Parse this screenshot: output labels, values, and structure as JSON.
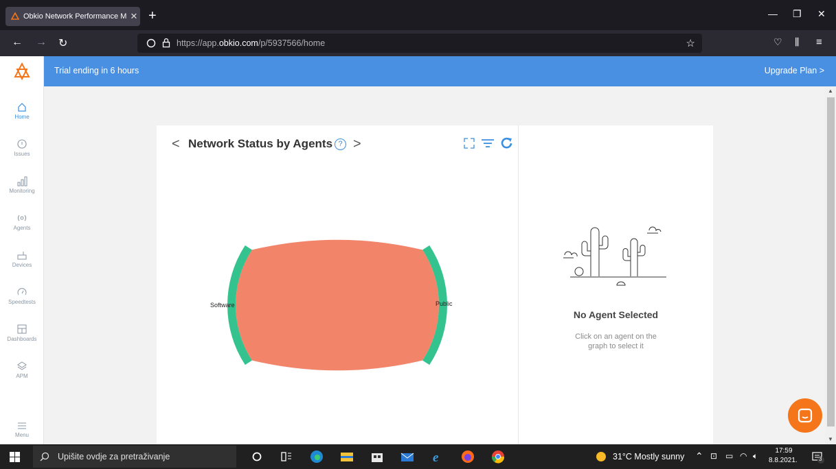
{
  "browser": {
    "tab_title": "Obkio Network Performance M",
    "tab_close": "✕",
    "new_tab": "+",
    "url_prefix": "https://app.",
    "url_domain": "obkio.com",
    "url_path": "/p/5937566/home"
  },
  "banner": {
    "message": "Trial ending in 6 hours",
    "upgrade_label": "Upgrade Plan >"
  },
  "sidebar": {
    "items": [
      {
        "label": "Home",
        "icon": "home-icon"
      },
      {
        "label": "Issues",
        "icon": "alert-circle-icon"
      },
      {
        "label": "Monitoring",
        "icon": "bar-chart-icon"
      },
      {
        "label": "Agents",
        "icon": "broadcast-icon"
      },
      {
        "label": "Devices",
        "icon": "router-icon"
      },
      {
        "label": "Speedtests",
        "icon": "gauge-icon"
      },
      {
        "label": "Dashboards",
        "icon": "dashboard-icon"
      },
      {
        "label": "APM",
        "icon": "layers-icon"
      }
    ],
    "menu_label": "Menu"
  },
  "widget": {
    "title": "Network Status by Agents",
    "help": "?",
    "prev": "<",
    "next": ">"
  },
  "chart_data": {
    "type": "chord",
    "nodes": [
      "Software",
      "Public"
    ],
    "colors": {
      "arc": "#34c38f",
      "ribbon": "#f2846a"
    }
  },
  "empty_state": {
    "title": "No Agent Selected",
    "line1": "Click on an agent on the",
    "line2": "graph to select it"
  },
  "taskbar": {
    "search_placeholder": "Upišite ovdje za pretraživanje",
    "weather": "31°C  Mostly sunny",
    "time": "17:59",
    "date": "8.8.2021.",
    "notifications": "3"
  }
}
